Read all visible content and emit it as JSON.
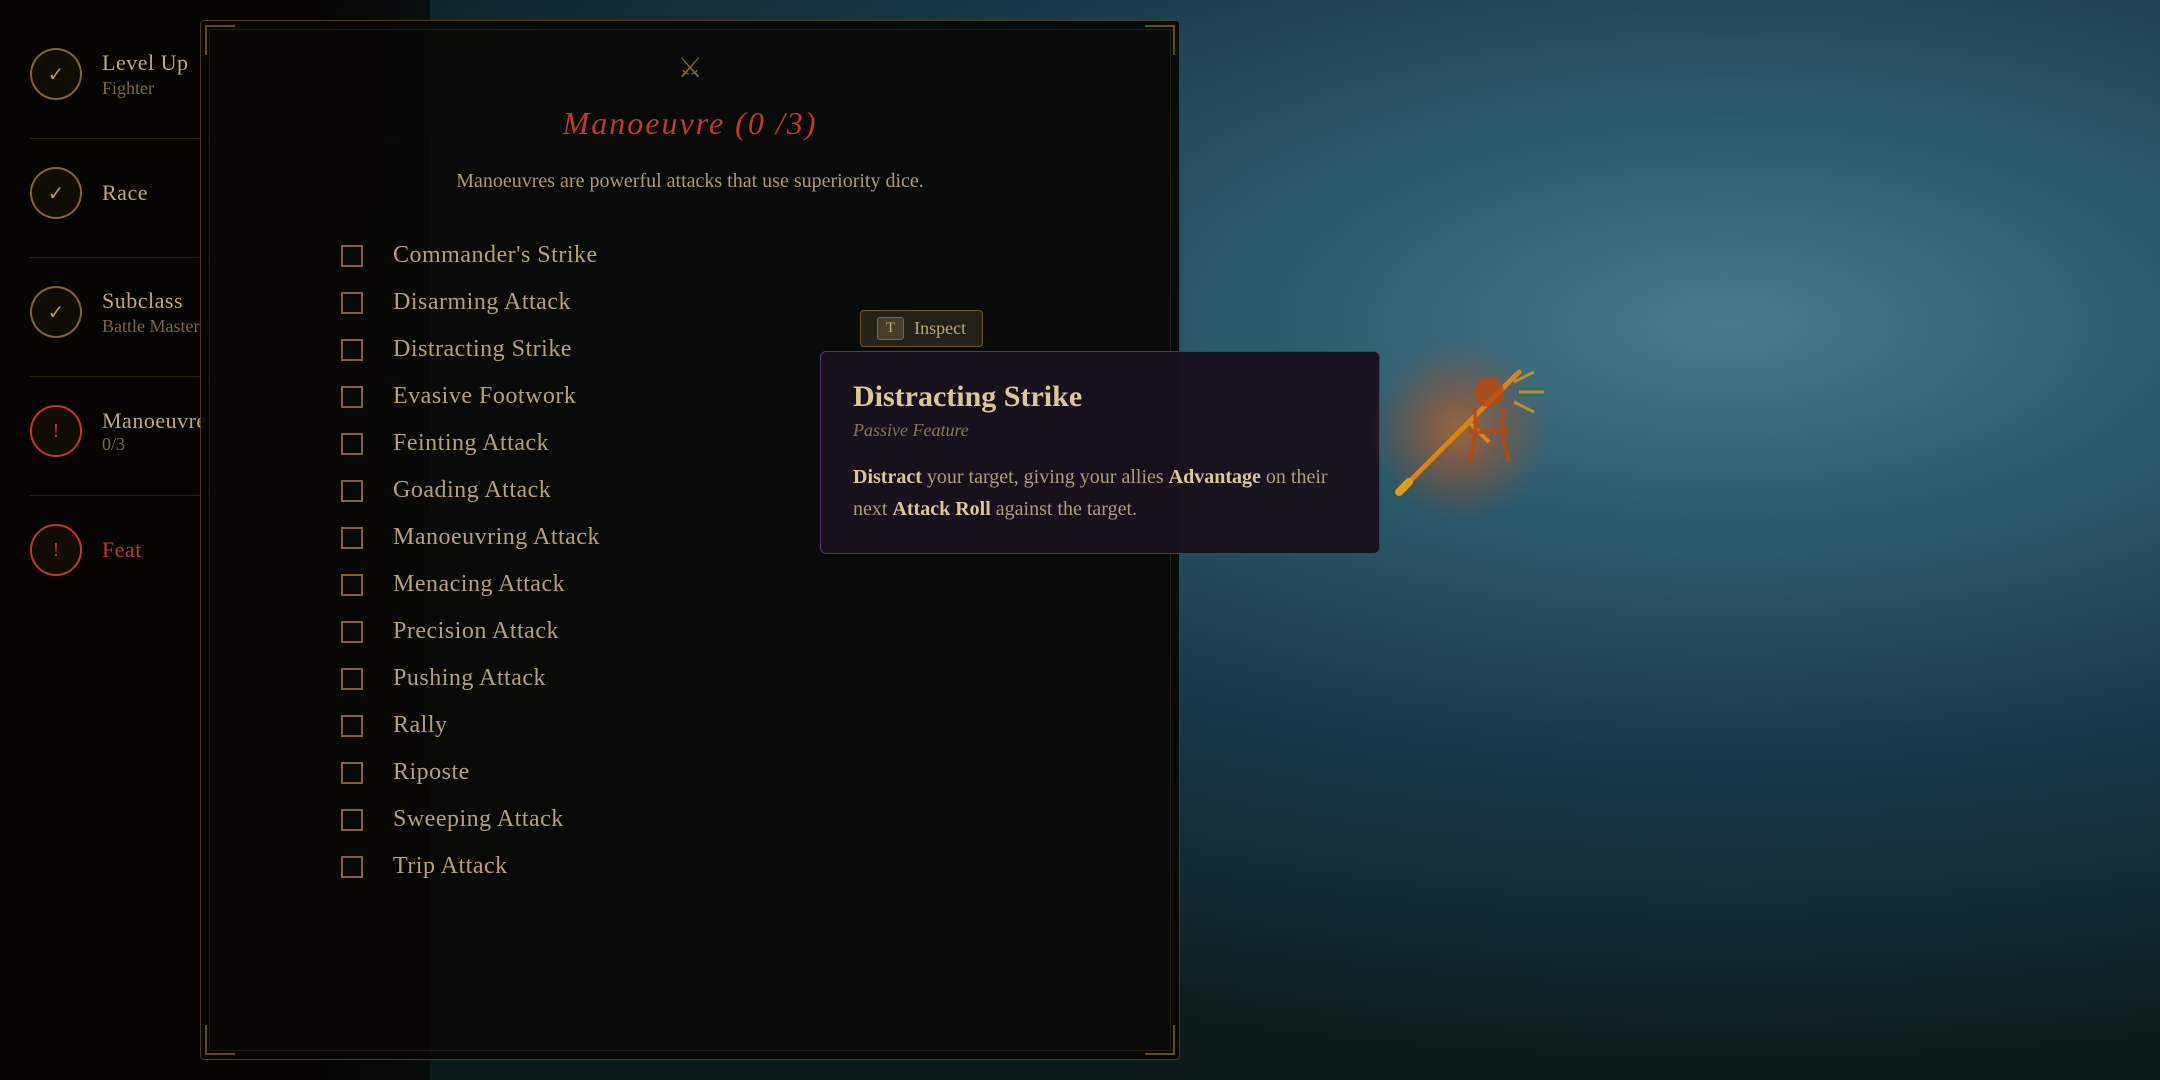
{
  "background": {
    "color": "#1a1a0e"
  },
  "sidebar": {
    "items": [
      {
        "id": "level-up",
        "icon": "✓",
        "icon_type": "checkmark",
        "label": "Level Up",
        "sublabel": "Fighter"
      },
      {
        "id": "race",
        "icon": "✓",
        "icon_type": "checkmark",
        "label": "Race",
        "sublabel": ""
      },
      {
        "id": "subclass",
        "icon": "✓",
        "icon_type": "checkmark",
        "label": "Subclass",
        "sublabel": "Battle Master"
      },
      {
        "id": "manoeuvre",
        "icon": "!",
        "icon_type": "alert",
        "label": "Manoeuvre",
        "sublabel": "0/3"
      },
      {
        "id": "feat",
        "icon": "!",
        "icon_type": "alert",
        "label": "Feat",
        "sublabel": ""
      }
    ]
  },
  "main_panel": {
    "top_icon": "⚔",
    "title": "Manoeuvre  (0 /3)",
    "description": "Manoeuvres are powerful attacks that use superiority dice.",
    "manoeuvres": [
      {
        "id": "commanders-strike",
        "label": "Commander's Strike",
        "checked": false
      },
      {
        "id": "disarming-attack",
        "label": "Disarming Attack",
        "checked": false
      },
      {
        "id": "distracting-strike",
        "label": "Distracting Strike",
        "checked": false
      },
      {
        "id": "evasive-footwork",
        "label": "Evasive Footwork",
        "checked": false
      },
      {
        "id": "feinting-attack",
        "label": "Feinting Attack",
        "checked": false
      },
      {
        "id": "goading-attack",
        "label": "Goading Attack",
        "checked": false
      },
      {
        "id": "manoeuvring-attack",
        "label": "Manoeuvring Attack",
        "checked": false
      },
      {
        "id": "menacing-attack",
        "label": "Menacing Attack",
        "checked": false
      },
      {
        "id": "precision-attack",
        "label": "Precision Attack",
        "checked": false
      },
      {
        "id": "pushing-attack",
        "label": "Pushing Attack",
        "checked": false
      },
      {
        "id": "rally",
        "label": "Rally",
        "checked": false
      },
      {
        "id": "riposte",
        "label": "Riposte",
        "checked": false
      },
      {
        "id": "sweeping-attack",
        "label": "Sweeping Attack",
        "checked": false
      },
      {
        "id": "trip-attack",
        "label": "Trip Attack",
        "checked": false
      }
    ]
  },
  "tooltip": {
    "inspect_key": "T",
    "inspect_label": "Inspect",
    "title": "Distracting Strike",
    "type": "Passive Feature",
    "description_parts": [
      {
        "text": "Distract",
        "highlight": true
      },
      {
        "text": " your target, giving your allies ",
        "highlight": false
      },
      {
        "text": "Advantage",
        "highlight": true
      },
      {
        "text": " on their next ",
        "highlight": false
      },
      {
        "text": "Attack Roll",
        "highlight": true
      },
      {
        "text": " against the target.",
        "highlight": false
      }
    ]
  }
}
